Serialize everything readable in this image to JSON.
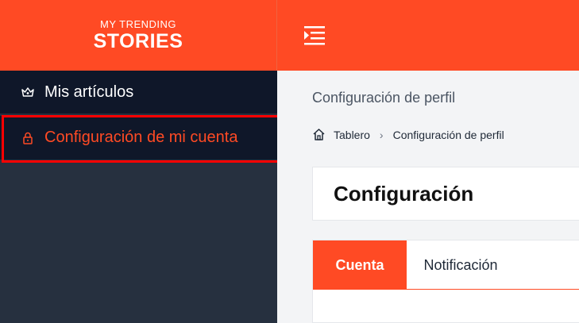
{
  "brand": {
    "line1": "MY TRENDING",
    "line2": "STORIES"
  },
  "sidebar": {
    "items": [
      {
        "label": "Mis artículos",
        "icon": "crown-icon"
      },
      {
        "label": "Configuración de mi cuenta",
        "icon": "lock-icon"
      }
    ]
  },
  "main": {
    "heading": "Configuración de perfil",
    "breadcrumb": {
      "home": "Tablero",
      "current": "Configuración de perfil"
    },
    "card_title": "Configuración",
    "tabs": [
      {
        "label": "Cuenta",
        "active": true
      },
      {
        "label": "Notificación",
        "active": false
      }
    ]
  },
  "colors": {
    "accent": "#ff4a24",
    "sidebar_bg": "#26303f",
    "sidebar_item_bg": "#0f1729",
    "highlight": "#ff0000"
  }
}
